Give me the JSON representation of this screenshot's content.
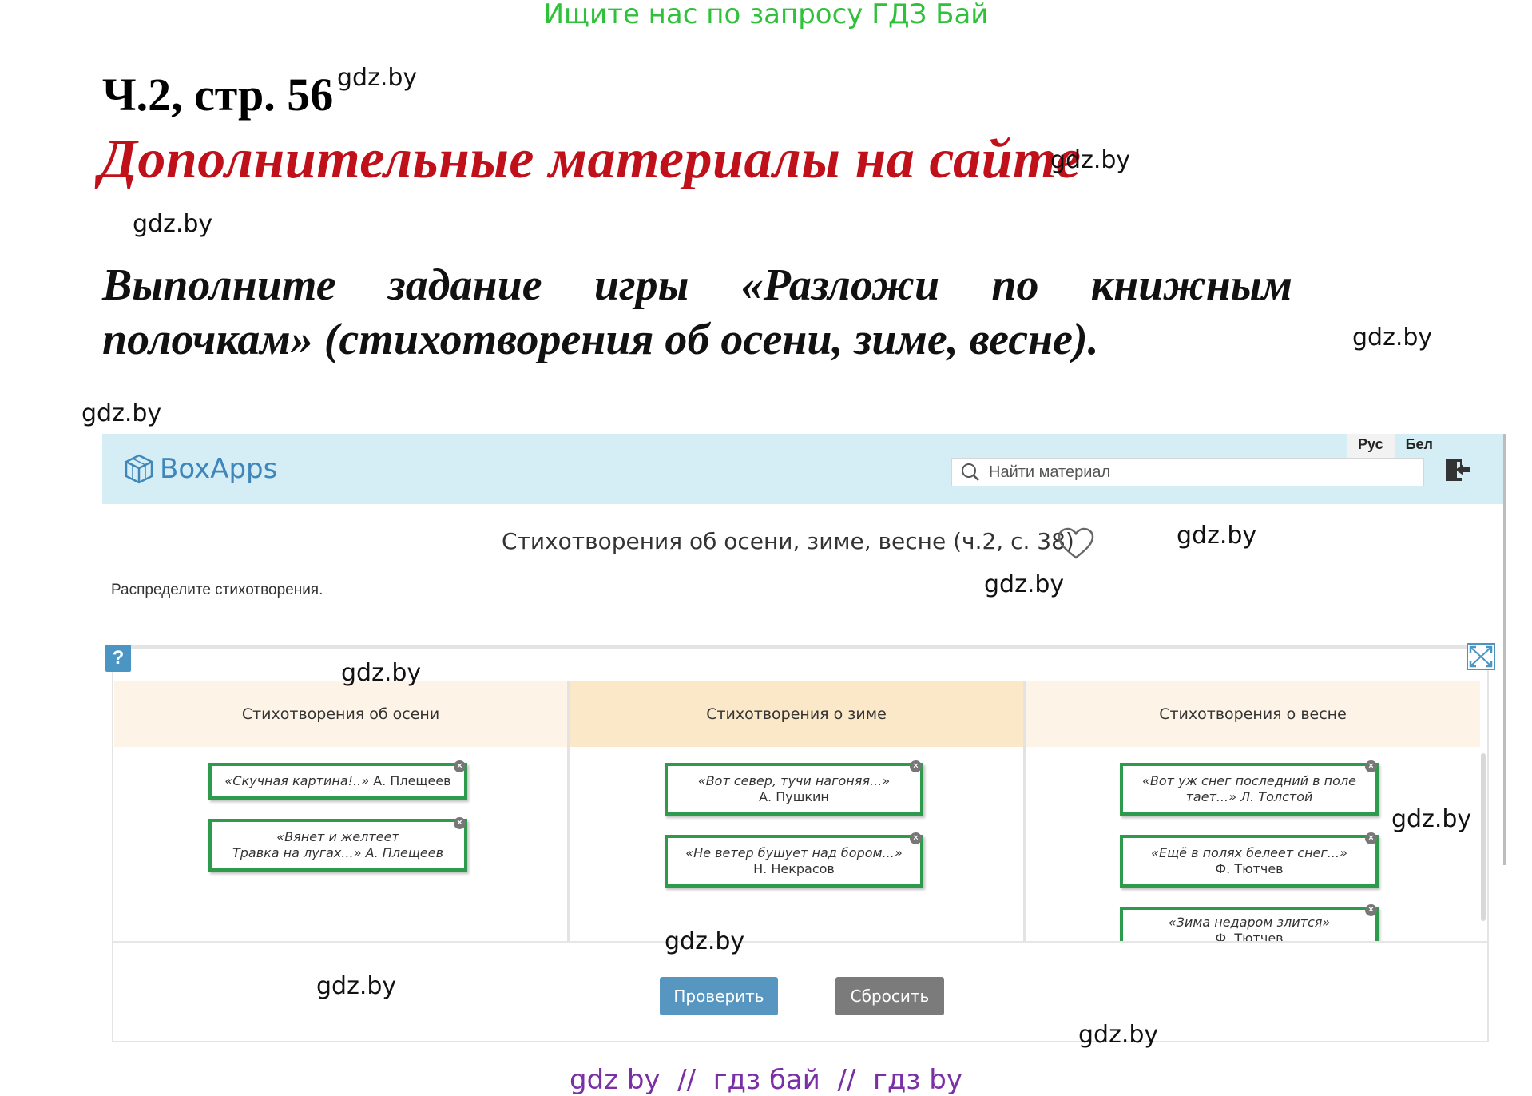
{
  "banner_top": "Ищите нас по запросу ГДЗ Бай",
  "page_ref": "Ч.2, стр. 56",
  "section_heading": "Дополнительные материалы на сайте",
  "task": {
    "line1_words": [
      "Выполните",
      "задание",
      "игры",
      "«Разложи",
      "по",
      "книжным"
    ],
    "line2": "полочкам» (стихотворения об осени, зиме, весне)."
  },
  "watermark": "gdz.by",
  "app": {
    "logo": "BoxApps",
    "lang": [
      "Рус",
      "Бел"
    ],
    "search_placeholder": "Найти материал",
    "material_title": "Стихотворения об осени, зиме, весне (ч.2, с. 38)",
    "instructions": "Распределите стихотворения.",
    "help_label": "?",
    "columns": [
      {
        "title": "Стихотворения об осени",
        "cards": [
          {
            "line1": "«Скучная картина!..»",
            "line2": "А. Плещеев"
          },
          {
            "line1": "«Вянет и желтеет",
            "line2": "Травка на лугах...» А. Плещеев"
          }
        ]
      },
      {
        "title": "Стихотворения о зиме",
        "cards": [
          {
            "line1": "«Вот север, тучи нагоняя...»",
            "line2": "А. Пушкин"
          },
          {
            "line1": "«Не ветер бушует над бором...»",
            "line2": "Н. Некрасов"
          }
        ]
      },
      {
        "title": "Стихотворения о весне",
        "cards": [
          {
            "line1": "«Вот уж снег последний в поле",
            "line2": "тает...» Л. Толстой"
          },
          {
            "line1": "«Ещё в полях белеет снег...»",
            "line2": "Ф. Тютчев"
          },
          {
            "line1": "«Зима недаром злится»",
            "line2": "Ф. Тютчев"
          }
        ]
      }
    ],
    "check_button": "Проверить",
    "reset_button": "Сбросить"
  },
  "banner_bottom": "gdz by  //  гдз бай  //  гдз by",
  "colors": {
    "banner_top": "#2ec13a",
    "heading": "#c0101a",
    "header_bg": "#d5eef6",
    "card_border": "#2e9a4b",
    "check_button": "#5696c1",
    "reset_button": "#7b7b7b",
    "banner_bottom": "#7a2fa6"
  }
}
